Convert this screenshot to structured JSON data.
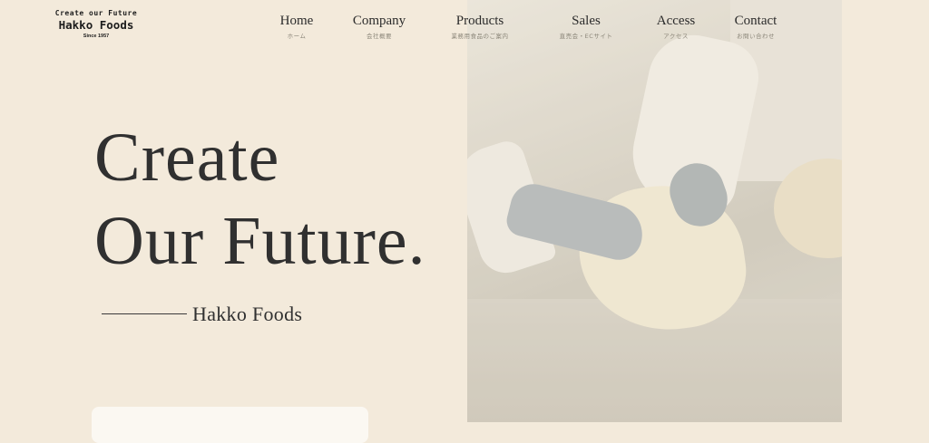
{
  "logo": {
    "tagline": "Create our Future",
    "name": "Hakko Foods",
    "since": "Since 1957"
  },
  "nav": {
    "items": [
      {
        "en": "Home",
        "ja": "ホーム"
      },
      {
        "en": "Company",
        "ja": "会社概要"
      },
      {
        "en": "Products",
        "ja": "業務用食品のご案内"
      },
      {
        "en": "Sales",
        "ja": "直売会・ECサイト"
      },
      {
        "en": "Access",
        "ja": "アクセス"
      },
      {
        "en": "Contact",
        "ja": "お問い合わせ"
      }
    ]
  },
  "hero": {
    "line1": "Create",
    "line2": "Our Future.",
    "subtitle": "Hakko Foods"
  },
  "colors": {
    "background": "#f3eadb",
    "text": "#303030",
    "accent_muted": "#8a8578"
  }
}
